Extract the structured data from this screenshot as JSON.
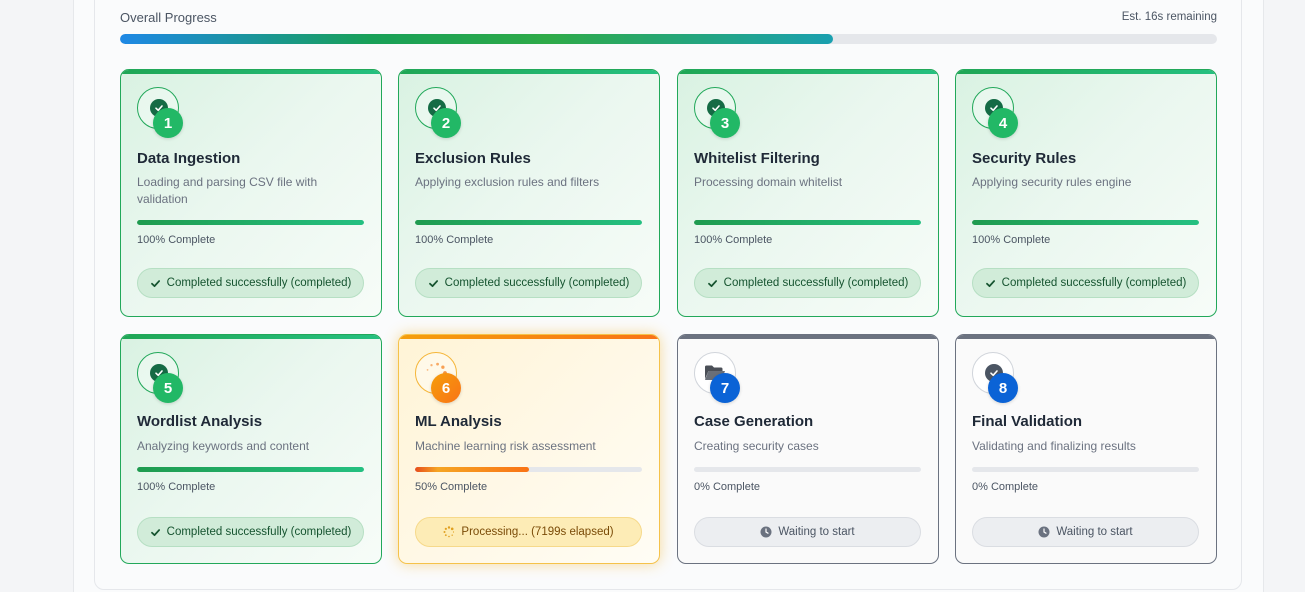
{
  "overall": {
    "label": "Overall Progress",
    "estimate": "Est. 16s remaining",
    "progress_percent": 65
  },
  "stages": [
    {
      "number": "1",
      "title": "Data Ingestion",
      "description": "Loading and parsing CSV file with validation",
      "percent": 100,
      "percent_label": "100% Complete",
      "status": "Completed successfully (completed)",
      "state": "completed"
    },
    {
      "number": "2",
      "title": "Exclusion Rules",
      "description": "Applying exclusion rules and filters",
      "percent": 100,
      "percent_label": "100% Complete",
      "status": "Completed successfully (completed)",
      "state": "completed"
    },
    {
      "number": "3",
      "title": "Whitelist Filtering",
      "description": "Processing domain whitelist",
      "percent": 100,
      "percent_label": "100% Complete",
      "status": "Completed successfully (completed)",
      "state": "completed"
    },
    {
      "number": "4",
      "title": "Security Rules",
      "description": "Applying security rules engine",
      "percent": 100,
      "percent_label": "100% Complete",
      "status": "Completed successfully (completed)",
      "state": "completed"
    },
    {
      "number": "5",
      "title": "Wordlist Analysis",
      "description": "Analyzing keywords and content",
      "percent": 100,
      "percent_label": "100% Complete",
      "status": "Completed successfully (completed)",
      "state": "completed"
    },
    {
      "number": "6",
      "title": "ML Analysis",
      "description": "Machine learning risk assessment",
      "percent": 50,
      "percent_label": "50% Complete",
      "status": "Processing... (7199s elapsed)",
      "state": "processing"
    },
    {
      "number": "7",
      "title": "Case Generation",
      "description": "Creating security cases",
      "percent": 0,
      "percent_label": "0% Complete",
      "status": "Waiting to start",
      "state": "waiting"
    },
    {
      "number": "8",
      "title": "Final Validation",
      "description": "Validating and finalizing results",
      "percent": 0,
      "percent_label": "0% Complete",
      "status": "Waiting to start",
      "state": "waiting"
    }
  ],
  "icons": {
    "completed": "check-circle-icon",
    "processing": "spinner-icon",
    "waiting": "clock-icon",
    "stage7": "folder-open-icon",
    "stage8": "check-circle-icon"
  },
  "colors": {
    "success": "#22b866",
    "processing": "#f59e0b",
    "waiting_badge": "#0b63d6"
  }
}
